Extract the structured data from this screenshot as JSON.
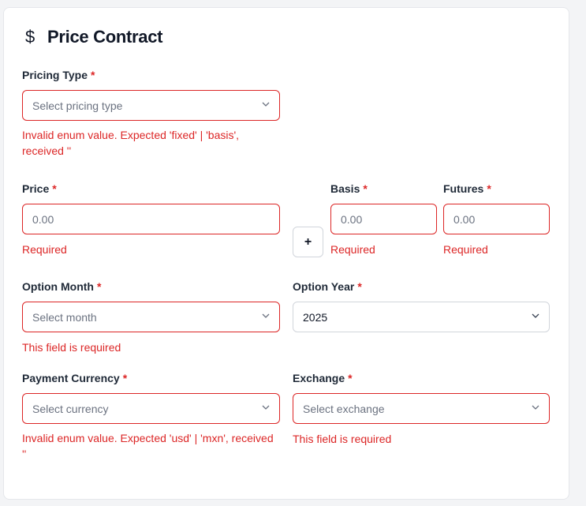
{
  "form": {
    "title": "Price Contract",
    "required_mark": "*",
    "pricing_type": {
      "label": "Pricing Type",
      "placeholder": "Select pricing type",
      "error": "Invalid enum value. Expected 'fixed' | 'basis', received ''"
    },
    "price": {
      "label": "Price",
      "placeholder": "0.00",
      "error": "Required"
    },
    "add_button": "+",
    "basis": {
      "label": "Basis",
      "placeholder": "0.00",
      "error": "Required"
    },
    "futures": {
      "label": "Futures",
      "placeholder": "0.00",
      "error": "Required"
    },
    "option_month": {
      "label": "Option Month",
      "placeholder": "Select month",
      "error": "This field is required"
    },
    "option_year": {
      "label": "Option Year",
      "value": "2025"
    },
    "payment_currency": {
      "label": "Payment Currency",
      "placeholder": "Select currency",
      "error": "Invalid enum value. Expected 'usd' | 'mxn', received ''"
    },
    "exchange": {
      "label": "Exchange",
      "placeholder": "Select exchange",
      "error": "This field is required"
    }
  },
  "colors": {
    "error": "#dc2626",
    "border": "#d1d5db",
    "text": "#111827"
  },
  "icons": {
    "title": "dollar-icon",
    "select": "chevron-down-icon"
  }
}
